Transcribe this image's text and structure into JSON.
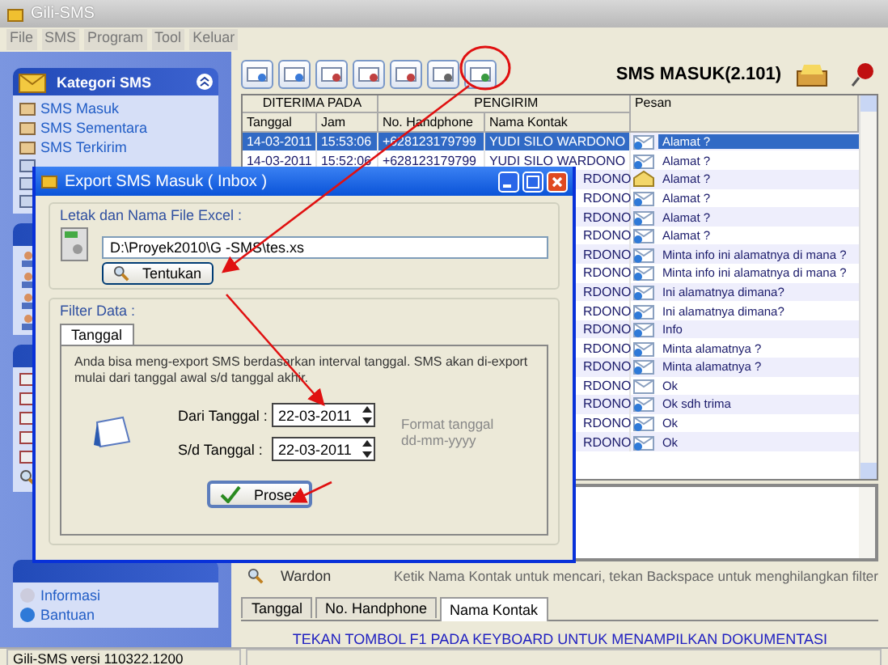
{
  "window": {
    "title": "Gili-SMS"
  },
  "menu": [
    "File",
    "SMS",
    "Program",
    "Tool",
    "Keluar"
  ],
  "sidebar": {
    "category_panel": {
      "title": "Kategori SMS",
      "items": [
        "SMS Masuk",
        "SMS Sementara",
        "SMS Terkirim"
      ]
    },
    "info_panel": {
      "items": [
        "Informasi",
        "Bantuan"
      ]
    }
  },
  "header": {
    "title": "SMS MASUK(2.101)"
  },
  "table": {
    "groups": [
      "DITERIMA PADA",
      "PENGIRIM",
      "Pesan"
    ],
    "columns": [
      "Tanggal",
      "Jam",
      "No. Handphone",
      "Nama Kontak"
    ],
    "rows": [
      {
        "date": "14-03-2011",
        "time": "15:53:06",
        "phone": "+628123179799",
        "name": "YUDI SILO WARDONO",
        "message": "Alamat ?",
        "kind": "unread",
        "selected": true
      },
      {
        "date": "14-03-2011",
        "time": "15:52:06",
        "phone": "+628123179799",
        "name": "YUDI SILO WARDONO",
        "message": "Alamat ?",
        "kind": "unread",
        "selected": false
      },
      {
        "name": "RDONO",
        "message": "Alamat ?",
        "kind": "open",
        "selected": false
      },
      {
        "name": "RDONO",
        "message": "Alamat ?",
        "kind": "unread",
        "selected": false
      },
      {
        "name": "RDONO",
        "message": "Alamat ?",
        "kind": "unread",
        "selected": false
      },
      {
        "name": "RDONO",
        "message": "Alamat ?",
        "kind": "unread",
        "selected": false
      },
      {
        "name": "RDONO",
        "message": "Minta info ini alamatnya di mana ?",
        "kind": "unread",
        "selected": false
      },
      {
        "name": "RDONO",
        "message": "Minta info ini alamatnya di mana ?",
        "kind": "unread",
        "selected": false
      },
      {
        "name": "RDONO",
        "message": "Ini alamatnya dimana?",
        "kind": "unread",
        "selected": false
      },
      {
        "name": "RDONO",
        "message": "Ini alamatnya dimana?",
        "kind": "unread",
        "selected": false
      },
      {
        "name": "RDONO",
        "message": "Info",
        "kind": "unread",
        "selected": false
      },
      {
        "name": "RDONO",
        "message": "Minta alamatnya ?",
        "kind": "unread",
        "selected": false
      },
      {
        "name": "RDONO",
        "message": "Minta alamatnya ?",
        "kind": "unread",
        "selected": false
      },
      {
        "name": "RDONO",
        "message": "Ok",
        "kind": "plain",
        "selected": false
      },
      {
        "name": "RDONO",
        "message": "Ok sdh trima",
        "kind": "unread",
        "selected": false
      },
      {
        "name": "RDONO",
        "message": "Ok",
        "kind": "unread",
        "selected": false
      },
      {
        "name": "RDONO",
        "message": "Ok",
        "kind": "unread",
        "selected": false
      }
    ]
  },
  "search": {
    "value": "Wardon",
    "hint": "Ketik Nama Kontak untuk mencari, tekan Backspace untuk menghilangkan filter"
  },
  "bottom_tabs": [
    {
      "label": "Tanggal",
      "selected": false
    },
    {
      "label": "No. Handphone",
      "selected": false
    },
    {
      "label": "Nama Kontak",
      "selected": true
    }
  ],
  "help_text": "TEKAN TOMBOL F1 PADA KEYBOARD UNTUK MENAMPILKAN DOKUMENTASI",
  "status_bar": "Gili-SMS versi 110322.1200",
  "dialog": {
    "title": "Export SMS Masuk ( Inbox )",
    "file_group": "Letak dan Nama File Excel :",
    "file_path": "D:\\Proyek2010\\G -SMS\\tes.xs",
    "browse_button": "Tentukan",
    "filter_group": "Filter Data :",
    "tab": "Tanggal",
    "description": "Anda bisa meng-export SMS berdasarkan interval tanggal. SMS akan di-export mulai dari tanggal awal s/d tanggal akhir.",
    "from_label": "Dari Tanggal :",
    "from_value": "22-03-2011",
    "to_label": "S/d Tanggal :",
    "to_value": "22-03-2011",
    "format_label": "Format tanggal",
    "format_value": "dd-mm-yyyy",
    "process_button": "Proses"
  }
}
